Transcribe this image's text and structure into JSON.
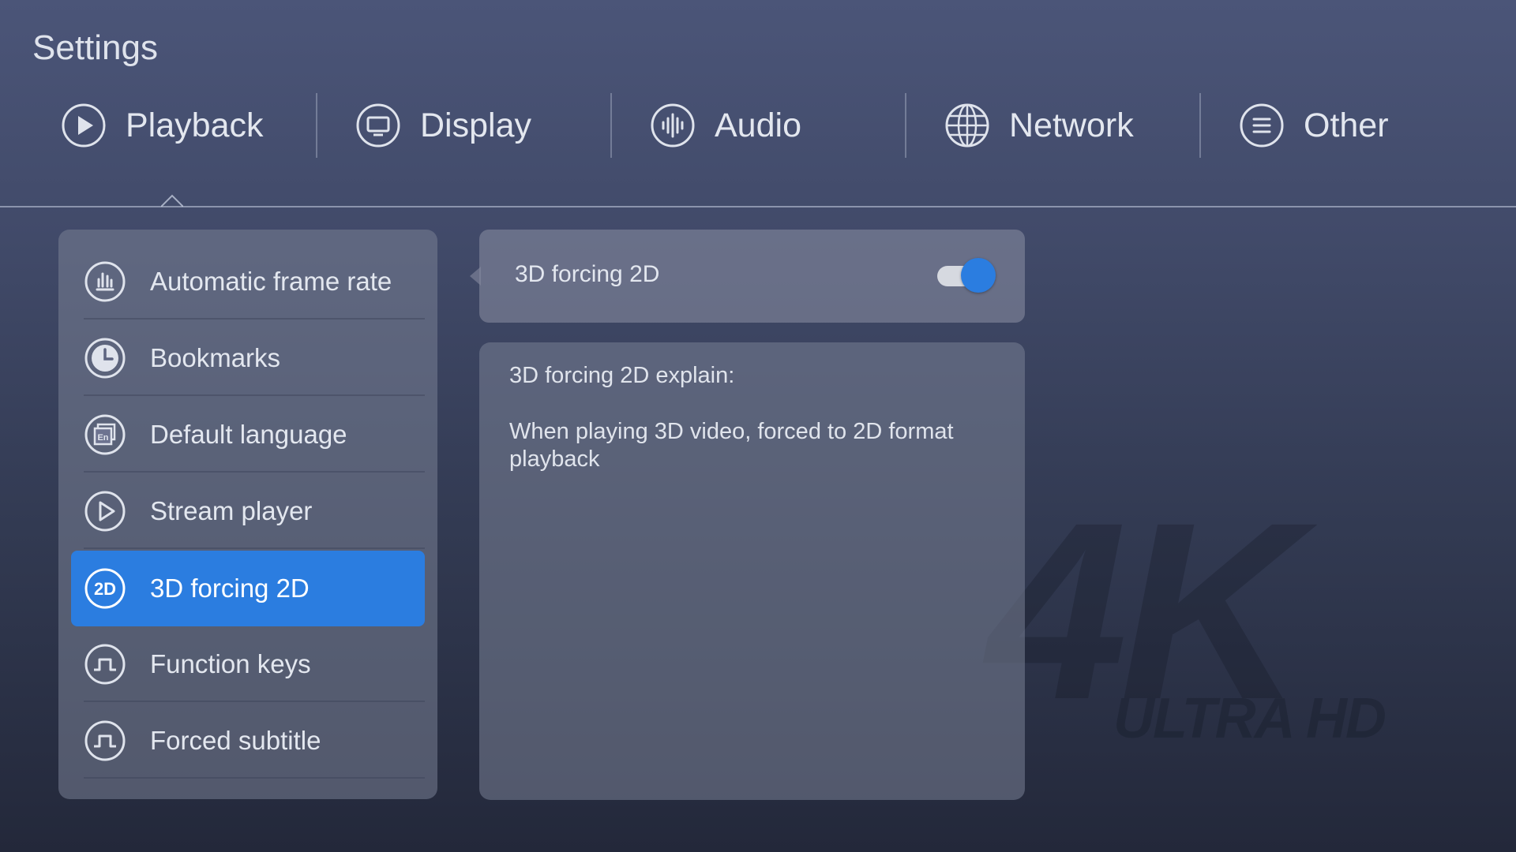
{
  "title": "Settings",
  "tabs": [
    {
      "label": "Playback",
      "icon": "play-circle-icon",
      "active": true
    },
    {
      "label": "Display",
      "icon": "monitor-icon"
    },
    {
      "label": "Audio",
      "icon": "audio-waveform-icon"
    },
    {
      "label": "Network",
      "icon": "globe-icon"
    },
    {
      "label": "Other",
      "icon": "menu-lines-icon"
    }
  ],
  "menu": [
    {
      "label": "Automatic frame rate",
      "icon": "bar-chart-icon"
    },
    {
      "label": "Bookmarks",
      "icon": "clock-icon"
    },
    {
      "label": "Default language",
      "icon": "language-icon"
    },
    {
      "label": "Stream player",
      "icon": "play-outline-icon"
    },
    {
      "label": "3D forcing 2D",
      "icon": "2d-icon",
      "active": true
    },
    {
      "label": "Function keys",
      "icon": "pulse-icon"
    },
    {
      "label": "Forced subtitle",
      "icon": "pulse-icon"
    }
  ],
  "setting": {
    "label": "3D forcing 2D",
    "toggle_on": true
  },
  "explain": {
    "heading": "3D forcing 2D explain:",
    "body": "When playing 3D video, forced to 2D format playback"
  },
  "watermark": {
    "big": "4K",
    "small": "ULTRA HD"
  },
  "colors": {
    "accent": "#2b7de0",
    "bg_top": "#4b5578",
    "bg_bottom": "#23283a"
  }
}
